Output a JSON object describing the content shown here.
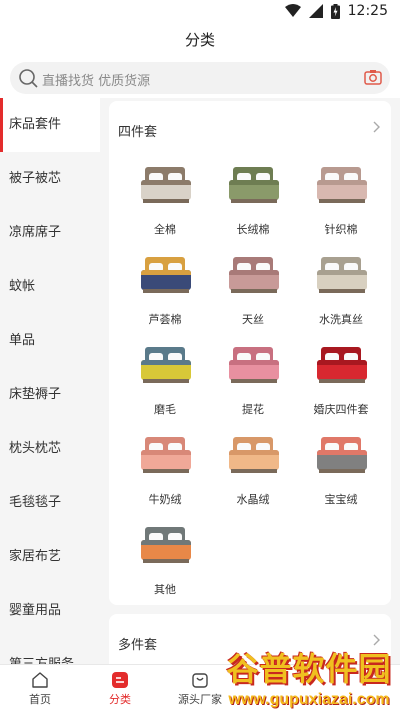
{
  "status_bar": {
    "time": "12:25"
  },
  "page_title": "分类",
  "search": {
    "placeholder": "直播找货 优质货源"
  },
  "sidebar": {
    "items": [
      {
        "label": "床品套件",
        "active": true
      },
      {
        "label": "被子被芯"
      },
      {
        "label": "凉席席子"
      },
      {
        "label": "蚊帐"
      },
      {
        "label": "单品"
      },
      {
        "label": "床垫褥子"
      },
      {
        "label": "枕头枕芯"
      },
      {
        "label": "毛毯毯子"
      },
      {
        "label": "家居布艺"
      },
      {
        "label": "婴童用品"
      },
      {
        "label": "第三方服务"
      }
    ]
  },
  "section1": {
    "title": "四件套",
    "items": [
      {
        "label": "全棉",
        "color": "#d9d2c8",
        "accent": "#8c7b6a"
      },
      {
        "label": "长绒棉",
        "color": "#8a9a6a",
        "accent": "#6e7d52"
      },
      {
        "label": "针织棉",
        "color": "#d8b8b0",
        "accent": "#b89a90"
      },
      {
        "label": "芦荟棉",
        "color": "#3a4a78",
        "accent": "#d8a040"
      },
      {
        "label": "天丝",
        "color": "#c89a98",
        "accent": "#a87a78"
      },
      {
        "label": "水洗真丝",
        "color": "#d8d0c0",
        "accent": "#a8a090"
      },
      {
        "label": "磨毛",
        "color": "#d8c838",
        "accent": "#5a7a8a"
      },
      {
        "label": "提花",
        "color": "#e890a0",
        "accent": "#c87080"
      },
      {
        "label": "婚庆四件套",
        "color": "#d82830",
        "accent": "#a81820"
      },
      {
        "label": "牛奶绒",
        "color": "#f0a898",
        "accent": "#d88878"
      },
      {
        "label": "水晶绒",
        "color": "#f0b888",
        "accent": "#d89868"
      },
      {
        "label": "宝宝绒",
        "color": "#808080",
        "accent": "#e07868"
      },
      {
        "label": "其他",
        "color": "#e88848",
        "accent": "#707878"
      }
    ]
  },
  "section2": {
    "title": "多件套"
  },
  "tabbar": {
    "tabs": [
      {
        "label": "首页"
      },
      {
        "label": "分类",
        "active": true
      },
      {
        "label": "源头厂家"
      },
      {
        "label": ""
      },
      {
        "label": ""
      }
    ]
  },
  "watermark": {
    "top": "谷普软件园",
    "bottom": "www.gupuxiazai.com"
  },
  "colors": {
    "accent": "#e32c2c"
  }
}
